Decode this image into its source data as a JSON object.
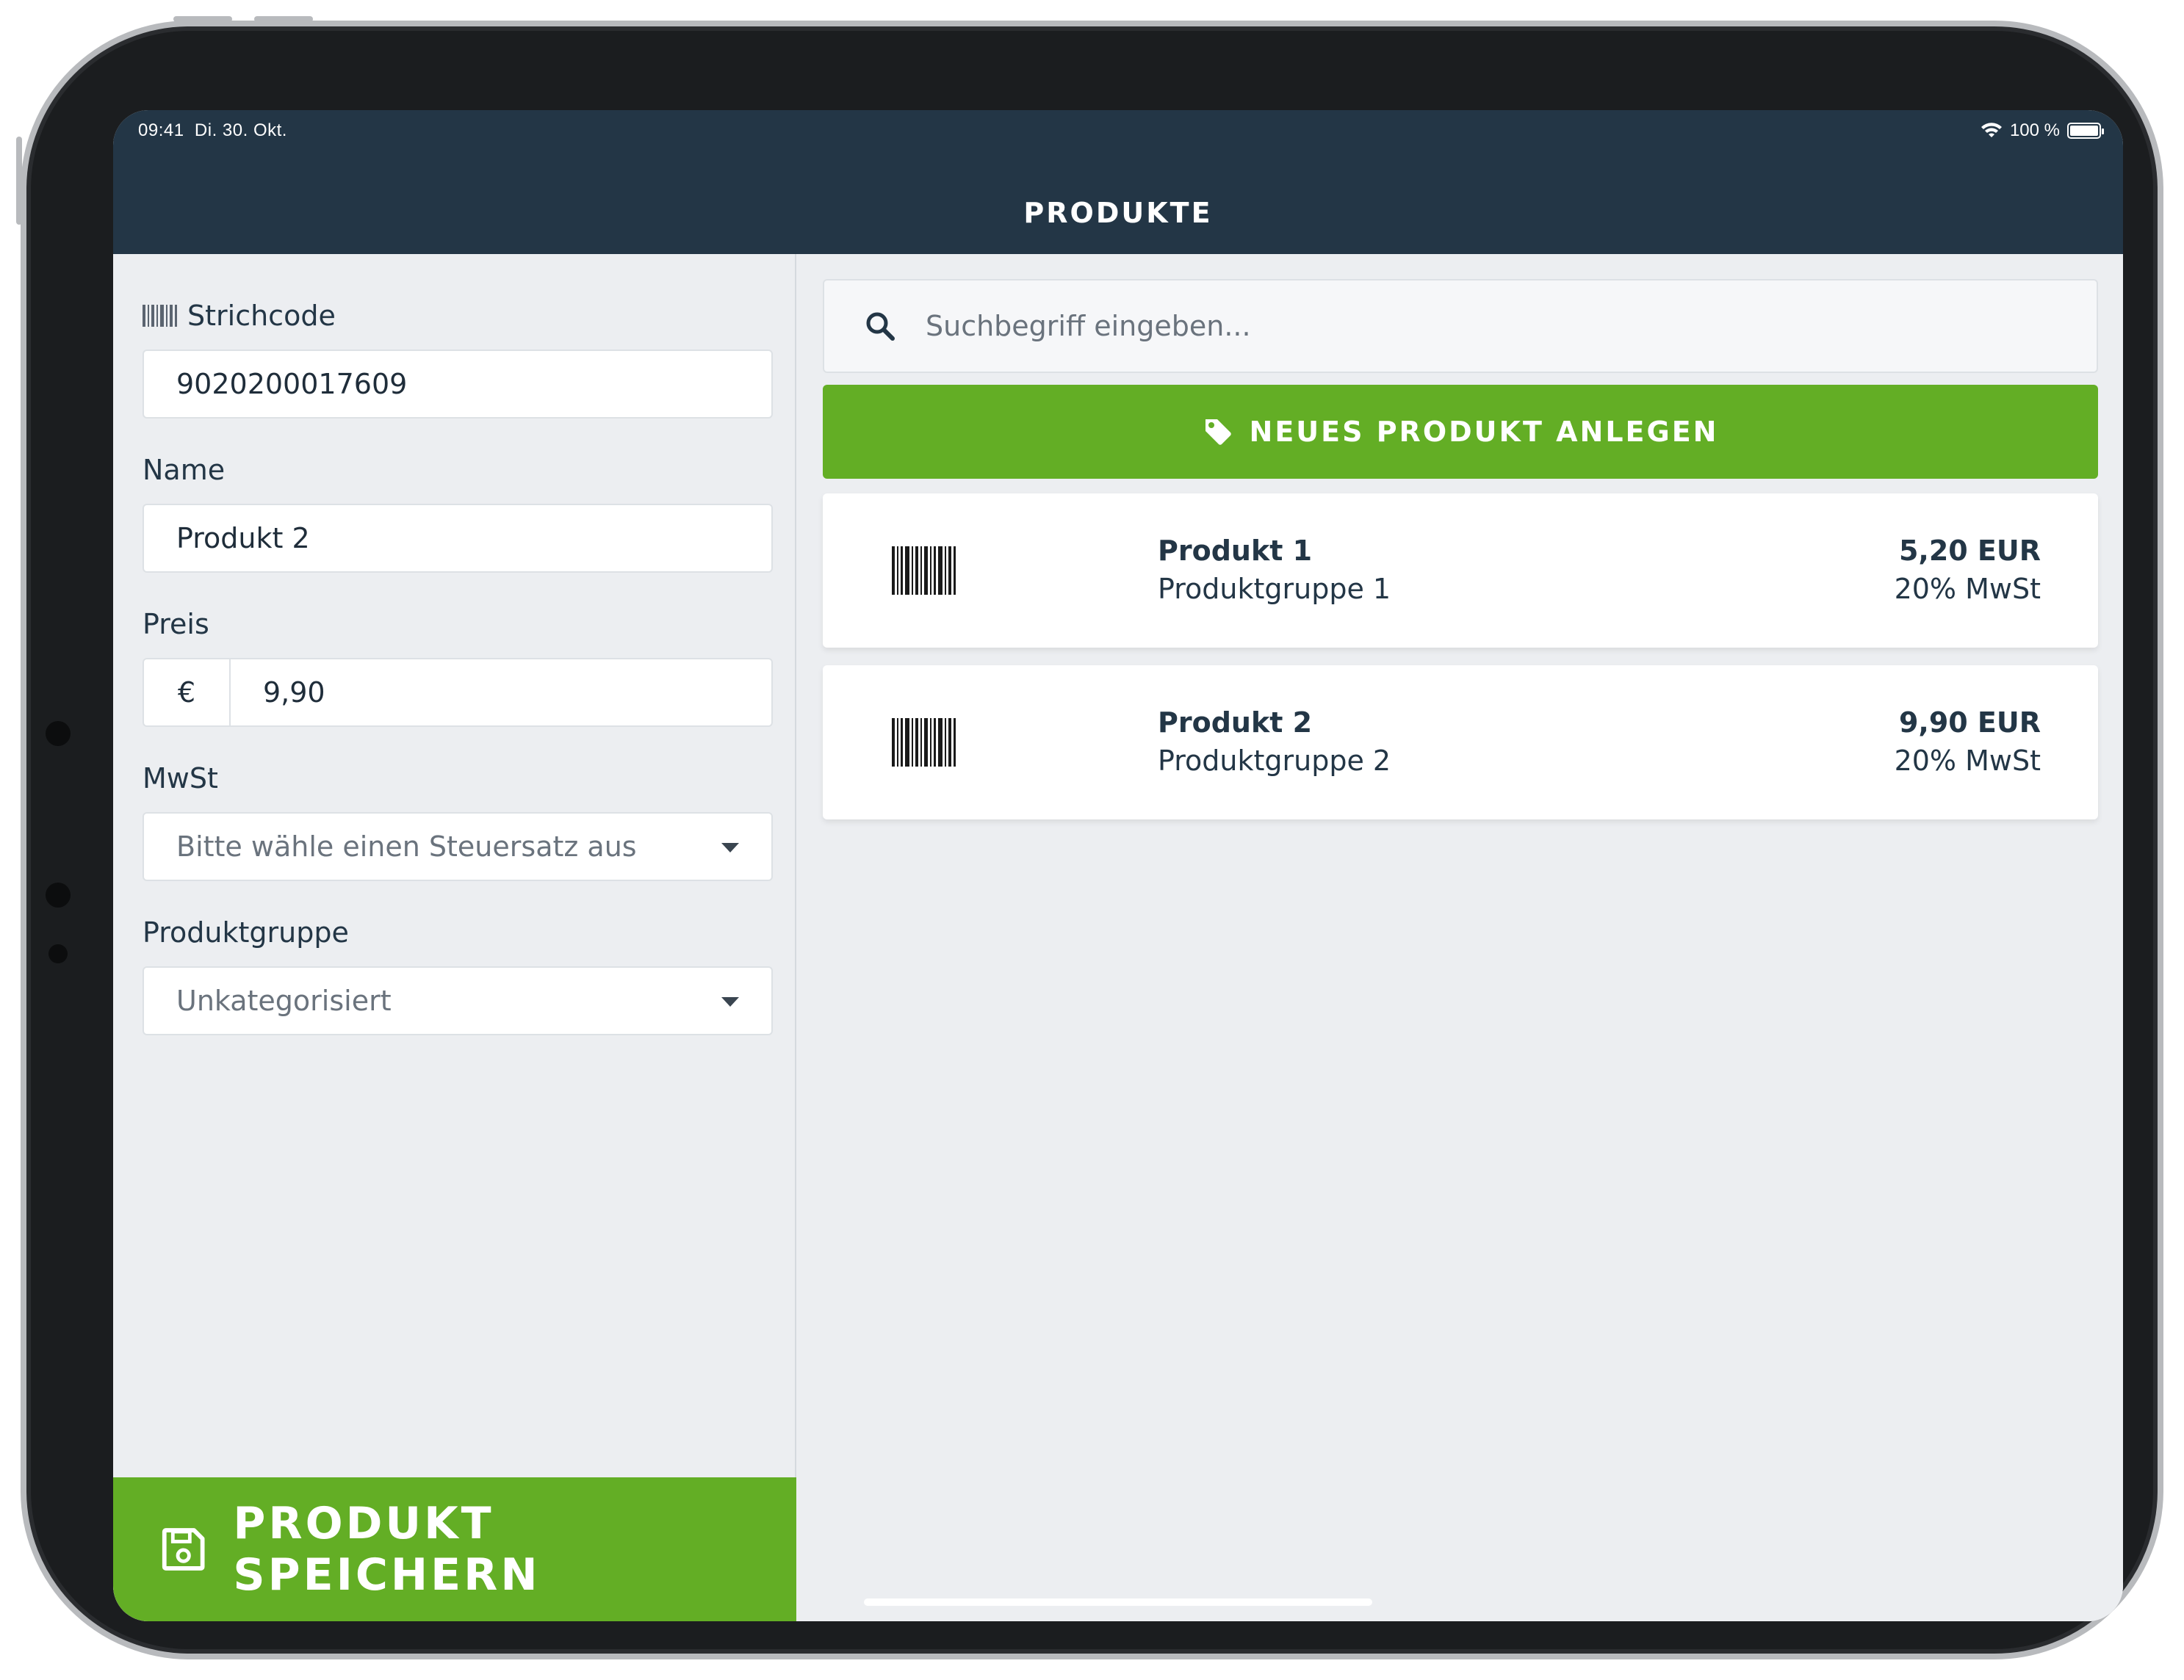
{
  "status_bar": {
    "time": "09:41",
    "date": "Di. 30. Okt.",
    "battery": "100 %"
  },
  "header": {
    "title": "PRODUKTE"
  },
  "form": {
    "barcode": {
      "label": "Strichcode",
      "value": "9020200017609"
    },
    "name": {
      "label": "Name",
      "value": "Produkt 2"
    },
    "price": {
      "label": "Preis",
      "currency": "€",
      "value": "9,90"
    },
    "tax": {
      "label": "MwSt",
      "placeholder": "Bitte wähle einen Steuersatz aus"
    },
    "group": {
      "label": "Produktgruppe",
      "value": "Unkategorisiert"
    },
    "save_label": "PRODUKT SPEICHERN"
  },
  "search": {
    "placeholder": "Suchbegriff eingeben..."
  },
  "new_product_label": "NEUES PRODUKT ANLEGEN",
  "products": [
    {
      "name": "Produkt 1",
      "group": "Produktgruppe 1",
      "price": "5,20 EUR",
      "tax": "20% MwSt"
    },
    {
      "name": "Produkt 2",
      "group": "Produktgruppe 2",
      "price": "9,90 EUR",
      "tax": "20% MwSt"
    }
  ],
  "colors": {
    "header": "#233646",
    "accent": "#63ae25",
    "background": "#eceef1"
  }
}
